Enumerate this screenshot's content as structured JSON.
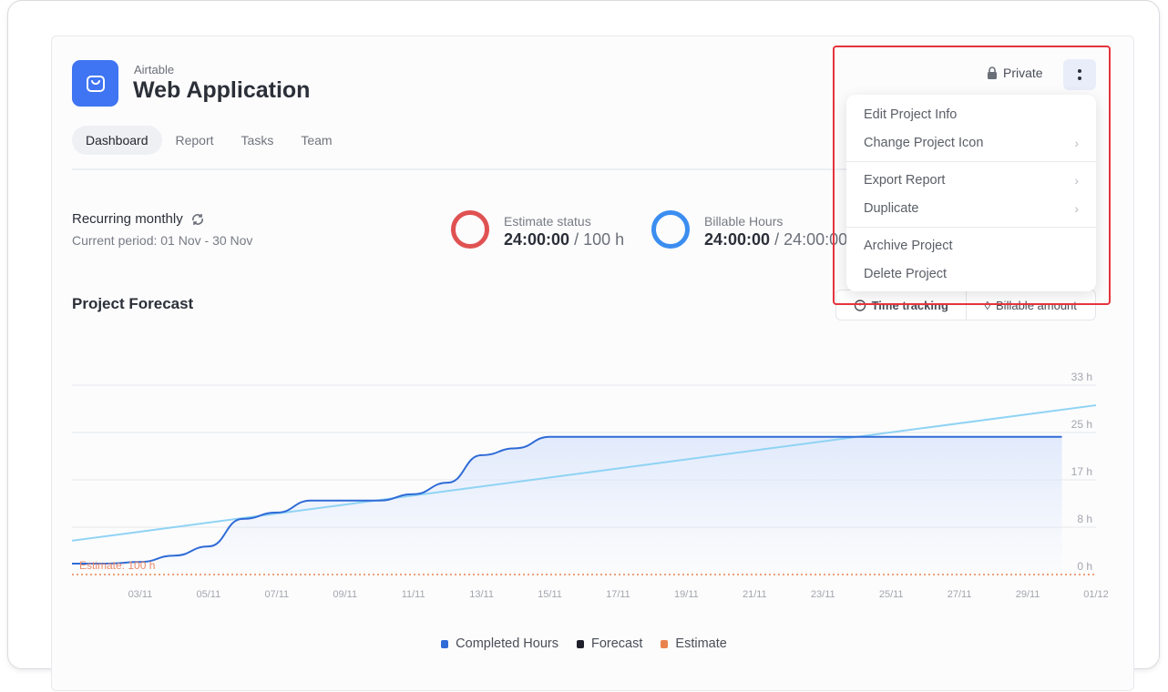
{
  "project": {
    "org": "Airtable",
    "title": "Web Application",
    "icon": "shopping-bag-icon"
  },
  "tabs": [
    {
      "label": "Dashboard",
      "active": true
    },
    {
      "label": "Report"
    },
    {
      "label": "Tasks"
    },
    {
      "label": "Team"
    }
  ],
  "recurring": {
    "label": "Recurring monthly",
    "period": "Current period: 01 Nov - 30 Nov"
  },
  "stats": [
    {
      "label": "Estimate status",
      "value": "24:00:00",
      "total": "/ 100 h",
      "color": "#e05252"
    },
    {
      "label": "Billable Hours",
      "value": "24:00:00",
      "total": "/ 24:00:00",
      "color": "#3b8ef0"
    }
  ],
  "header": {
    "privacy": "Private"
  },
  "menu": {
    "items": [
      {
        "label": "Edit Project Info",
        "submenu": false
      },
      {
        "label": "Change Project Icon",
        "submenu": true
      },
      {
        "label": "Export Report",
        "submenu": true
      },
      {
        "label": "Duplicate",
        "submenu": true
      },
      {
        "label": "Archive Project",
        "submenu": false
      },
      {
        "label": "Delete Project",
        "submenu": false
      }
    ]
  },
  "forecast": {
    "title": "Project Forecast",
    "toggle": [
      "Time tracking",
      "Billable amount"
    ]
  },
  "chart_data": {
    "type": "line",
    "x_ticks": [
      "03/11",
      "05/11",
      "07/11",
      "09/11",
      "11/11",
      "13/11",
      "15/11",
      "17/11",
      "19/11",
      "21/11",
      "23/11",
      "25/11",
      "27/11",
      "29/11",
      "01/12"
    ],
    "y_ticks": [
      "0 h",
      "8 h",
      "17 h",
      "25 h",
      "33 h"
    ],
    "ylim": [
      0,
      33
    ],
    "grid": true,
    "legend_position": "bottom",
    "estimate_label": "Estimate: 100 h",
    "series": [
      {
        "name": "Completed Hours",
        "color": "#2f6bd6",
        "x": [
          "01/11",
          "02/11",
          "03/11",
          "04/11",
          "05/11",
          "06/11",
          "07/11",
          "08/11",
          "09/11",
          "10/11",
          "11/11",
          "12/11",
          "13/11",
          "14/11",
          "15/11",
          "30/11"
        ],
        "values": [
          1.9,
          1.9,
          2.2,
          3.3,
          4.9,
          9.7,
          10.8,
          12.9,
          12.9,
          12.9,
          14,
          16,
          20.8,
          22,
          24,
          24
        ]
      },
      {
        "name": "Forecast",
        "color": "#1e1f2b",
        "line_color": "#8fd3f4",
        "x": [
          "01/11",
          "01/12"
        ],
        "values": [
          5.9,
          29.5
        ]
      },
      {
        "name": "Estimate",
        "color": "#e8834d",
        "value": 0
      }
    ]
  }
}
